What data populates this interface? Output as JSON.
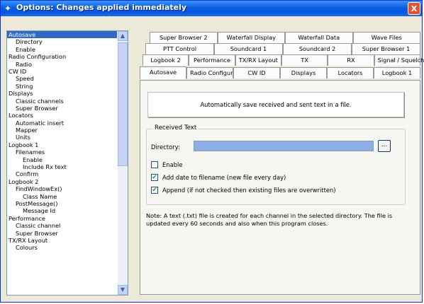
{
  "window": {
    "title": "Options: Changes applied immediately",
    "close_glyph": "X",
    "title_icon": "app-icon"
  },
  "tree": {
    "items": [
      {
        "label": "Autosave",
        "indent": 0,
        "selected": true
      },
      {
        "label": "Directory",
        "indent": 1
      },
      {
        "label": "Enable",
        "indent": 1
      },
      {
        "label": "Radio Configuration",
        "indent": 0
      },
      {
        "label": "Radio",
        "indent": 1
      },
      {
        "label": "CW ID",
        "indent": 0
      },
      {
        "label": "Speed",
        "indent": 1
      },
      {
        "label": "String",
        "indent": 1
      },
      {
        "label": "Displays",
        "indent": 0
      },
      {
        "label": "Classic channels",
        "indent": 1
      },
      {
        "label": "Super Browser",
        "indent": 1
      },
      {
        "label": "Locators",
        "indent": 0
      },
      {
        "label": "Automatic insert",
        "indent": 1
      },
      {
        "label": "Mapper",
        "indent": 1
      },
      {
        "label": "Units",
        "indent": 1
      },
      {
        "label": "Logbook 1",
        "indent": 0
      },
      {
        "label": "Filenames",
        "indent": 1
      },
      {
        "label": "Enable",
        "indent": 2
      },
      {
        "label": "Include Rx text",
        "indent": 2
      },
      {
        "label": "Confirm",
        "indent": 1
      },
      {
        "label": "Logbook 2",
        "indent": 0
      },
      {
        "label": "FindWindowEx()",
        "indent": 1
      },
      {
        "label": "Class Name",
        "indent": 2
      },
      {
        "label": "PostMessage()",
        "indent": 1
      },
      {
        "label": "Message Id",
        "indent": 2
      },
      {
        "label": "Performance",
        "indent": 0
      },
      {
        "label": "Classic channel",
        "indent": 1
      },
      {
        "label": "Super Browser",
        "indent": 1
      },
      {
        "label": "TX/RX Layout",
        "indent": 0
      },
      {
        "label": "Colours",
        "indent": 1
      }
    ],
    "scroll_up": "▲",
    "scroll_down": "▼"
  },
  "tabs": {
    "row1": [
      "Super Browser 2",
      "Waterfall Display",
      "Waterfall Data",
      "Wave Files"
    ],
    "row2": [
      "PTT Control",
      "Soundcard 1",
      "Soundcard 2",
      "Super Browser 1"
    ],
    "row3": [
      "Logbook 2",
      "Performance",
      "TX/RX Layout",
      "TX",
      "RX",
      "Signal / Squelch"
    ],
    "row4": [
      "Autosave",
      "Radio Configuration",
      "CW ID",
      "Displays",
      "Locators",
      "Logbook 1"
    ],
    "active": "Autosave"
  },
  "panel": {
    "info_text": "Automatically save received and sent text in a file.",
    "group_title": "Received Text",
    "directory_label": "Directory:",
    "directory_value": "",
    "browse_label": "...",
    "checkboxes": [
      {
        "label": "Enable",
        "checked": false
      },
      {
        "label": "Add date to filename (new file every day)",
        "checked": true
      },
      {
        "label": "Append (if not checked then existing files are overwritten)",
        "checked": true
      }
    ],
    "note": "Note: A text (.txt) file is created for each channel in the selected directory. The file is updated every 60 seconds and also when this program closes.",
    "checkmark": "✔"
  },
  "colors": {
    "title_bar": "#0054e3",
    "selection": "#316ac5",
    "directory_field": "#8cb0e6"
  }
}
